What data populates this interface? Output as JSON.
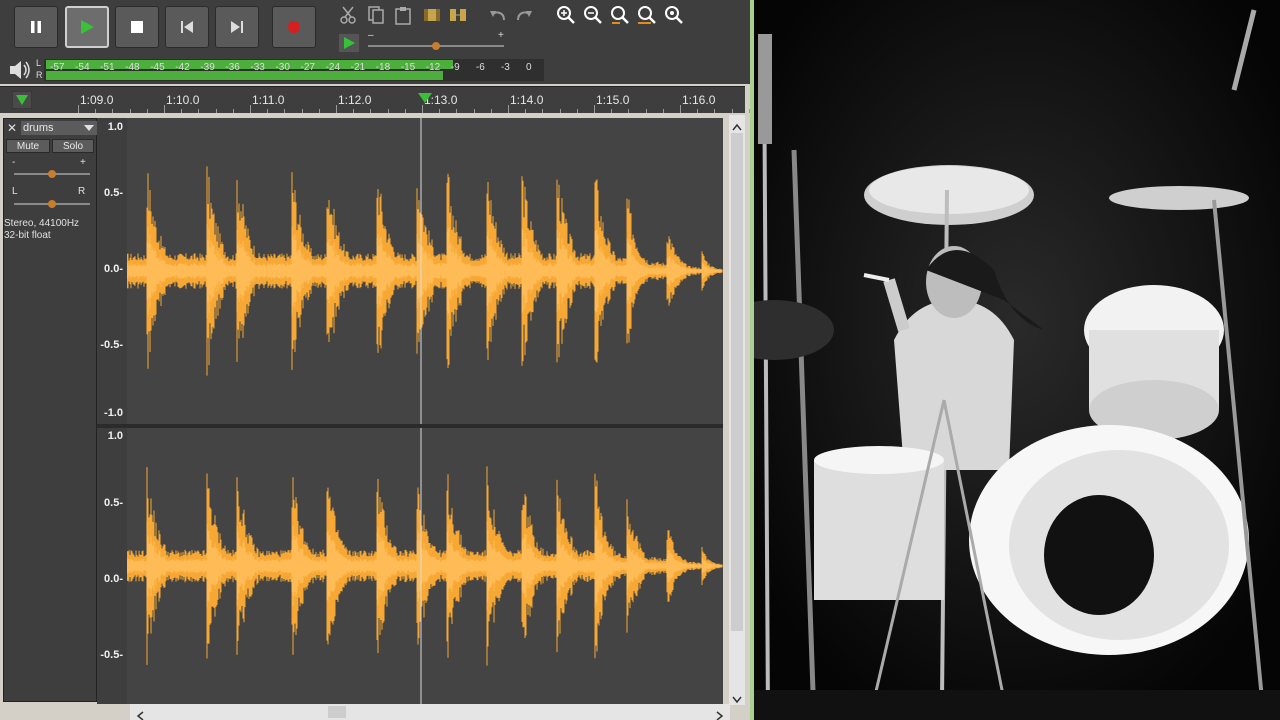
{
  "transport": {
    "buttons": [
      {
        "name": "pause-button",
        "icon": "pause-icon"
      },
      {
        "name": "play-button",
        "icon": "play-icon",
        "active": true
      },
      {
        "name": "stop-button",
        "icon": "stop-icon"
      },
      {
        "name": "skip-to-start-button",
        "icon": "skip-start-icon"
      },
      {
        "name": "skip-to-end-button",
        "icon": "skip-end-icon"
      },
      {
        "name": "record-button",
        "icon": "record-icon"
      }
    ]
  },
  "edit_tools": [
    "cut-icon",
    "copy-icon",
    "paste-icon",
    "trim-icon",
    "silence-icon",
    "undo-icon",
    "redo-icon",
    "zoom-in-icon",
    "zoom-out-icon",
    "fit-selection-icon",
    "fit-project-icon",
    "zoom-toggle-icon"
  ],
  "play_at_speed": {
    "minus": "–",
    "plus": "+",
    "value": 0.5
  },
  "meter": {
    "left_label": "L",
    "right_label": "R",
    "ticks": [
      "-57",
      "-54",
      "-51",
      "-48",
      "-45",
      "-42",
      "-39",
      "-36",
      "-33",
      "-30",
      "-27",
      "-24",
      "-21",
      "-18",
      "-15",
      "-12",
      "-9",
      "-6",
      "-3",
      "0"
    ],
    "level_left": 0.82,
    "level_right": 0.8
  },
  "timeline": {
    "labels": [
      "1:09.0",
      "1:10.0",
      "1:11.0",
      "1:12.0",
      "1:13.0",
      "1:14.0",
      "1:15.0",
      "1:16.0"
    ],
    "playhead_fraction": 0.5
  },
  "track": {
    "name": "drums",
    "mute_label": "Mute",
    "solo_label": "Solo",
    "gain_minus": "-",
    "gain_plus": "+",
    "pan_left": "L",
    "pan_right": "R",
    "gain_value": 0.5,
    "pan_value": 0.5,
    "info_line1": "Stereo, 44100Hz",
    "info_line2": "32-bit float",
    "vruler_top": [
      "1.0",
      "0.5-",
      "0.0-",
      "-0.5-",
      "-1.0"
    ],
    "vruler_bottom": [
      "1.0",
      "0.5-",
      "0.0-",
      "-0.5-"
    ]
  },
  "colors": {
    "waveform": "#f6a734",
    "waveform_core": "#ffbb55",
    "background": "#444444",
    "accent_green": "#4caf3c"
  }
}
